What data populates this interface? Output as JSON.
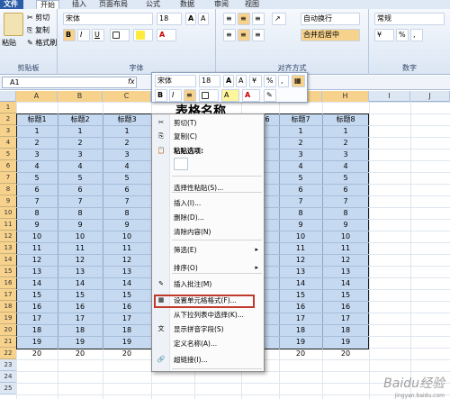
{
  "tabs": [
    "文件",
    "开始",
    "插入",
    "页面布局",
    "公式",
    "数据",
    "审阅",
    "视图"
  ],
  "ribbon": {
    "clipboard": {
      "paste": "粘贴",
      "cut": "剪切",
      "copy": "复制",
      "format_painter": "格式刷",
      "label": "剪贴板"
    },
    "font": {
      "name": "宋体",
      "size": "18",
      "bold": "B",
      "italic": "I",
      "underline": "U",
      "grow": "A",
      "shrink": "A",
      "label": "字体"
    },
    "align": {
      "wrap": "自动换行",
      "merge": "合并后居中",
      "label": "对齐方式"
    },
    "number": {
      "format": "常规",
      "percent": "%",
      "comma": ",",
      "label": "数字"
    }
  },
  "namebox": "A1",
  "fx": "fx",
  "columns": [
    "A",
    "B",
    "C",
    "D",
    "E",
    "F",
    "G",
    "H",
    "I",
    "J"
  ],
  "rows": [
    "1",
    "2",
    "3",
    "4",
    "5",
    "6",
    "7",
    "8",
    "9",
    "10",
    "11",
    "12",
    "13",
    "14",
    "15",
    "16",
    "17",
    "18",
    "19",
    "20",
    "21",
    "22",
    "23",
    "24",
    "25"
  ],
  "sheet": {
    "title": "表格名称",
    "headers": [
      "标题1",
      "标题2",
      "标题3",
      "",
      "",
      "标题6",
      "标题7",
      "标题8"
    ],
    "values": [
      "1",
      "2",
      "3",
      "4",
      "5",
      "6",
      "7",
      "8",
      "9",
      "10",
      "11",
      "12",
      "13",
      "14",
      "15",
      "16",
      "17",
      "18",
      "19",
      "20"
    ]
  },
  "mini": {
    "font": "宋体",
    "size": "18",
    "grow": "A",
    "shrink": "A",
    "percent": "%",
    "comma": ",",
    "bold": "B",
    "italic": "I",
    "align": "≡",
    "fill": "A",
    "font_color": "A"
  },
  "menu": [
    {
      "label": "剪切(T)",
      "icon": "✂"
    },
    {
      "label": "复制(C)",
      "icon": "⎘"
    },
    {
      "label": "粘贴选项:",
      "icon": "📋"
    },
    {
      "label": "",
      "icon": ""
    },
    {
      "label": "选择性粘贴(S)...",
      "icon": ""
    },
    {
      "label": "插入(I)...",
      "icon": ""
    },
    {
      "label": "删除(D)...",
      "icon": ""
    },
    {
      "label": "清除内容(N)",
      "icon": ""
    },
    {
      "label": "筛选(E)",
      "icon": ""
    },
    {
      "label": "排序(O)",
      "icon": ""
    },
    {
      "label": "插入批注(M)",
      "icon": "✎"
    },
    {
      "label": "设置单元格格式(F)...",
      "icon": "▦"
    },
    {
      "label": "从下拉列表中选择(K)...",
      "icon": ""
    },
    {
      "label": "显示拼音字段(S)",
      "icon": "文"
    },
    {
      "label": "定义名称(A)...",
      "icon": ""
    },
    {
      "label": "超链接(I)...",
      "icon": "🔗"
    }
  ],
  "watermark": "Baidu经验",
  "watermark_url": "jingyan.baidu.com"
}
